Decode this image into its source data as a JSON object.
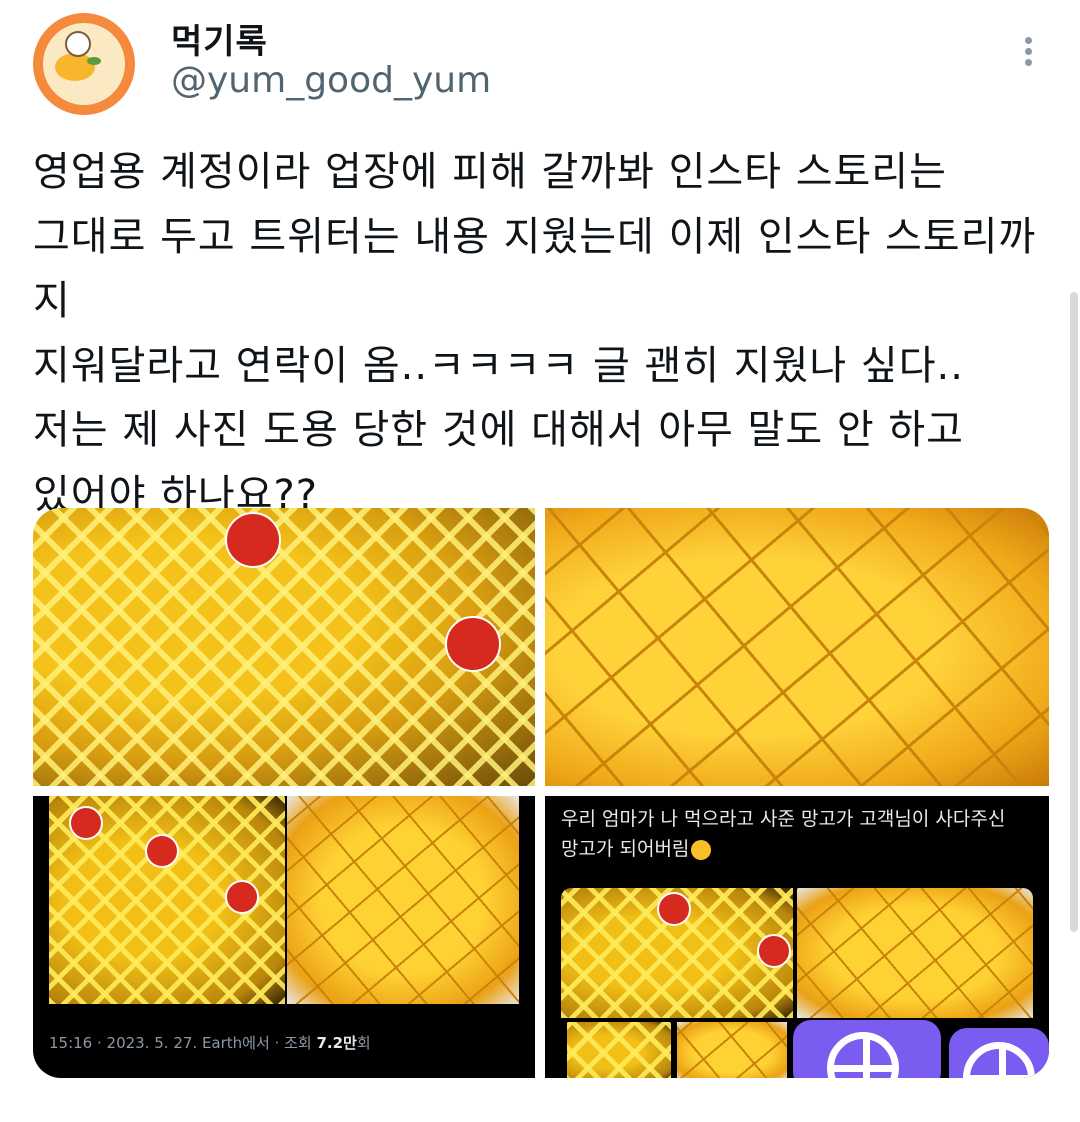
{
  "header": {
    "display_name": "먹기록",
    "handle": "@yum_good_yum",
    "avatar_icon": "cartoon-food-avatar",
    "more_icon": "more-vertical-icon"
  },
  "tweet": {
    "text": "영업용 계정이라 업장에 피해 갈까봐 인스타 스토리는\n그대로 두고 트위터는 내용 지웠는데 이제 인스타 스토리까지\n지워달라고 연락이 옴..ㅋㅋㅋㅋ 글 괜히 지웠나 싶다..\n저는 제 사진 도용 당한 것에 대해서 아무 말도 안 하고\n있어야 하나요??"
  },
  "media": {
    "image1": "mango-box-photo",
    "image2": "cut-mango-photo",
    "image3": {
      "meta_prefix": "15:16 · 2023. 5. 27. Earth에서 · 조회 ",
      "meta_views": "7.2만",
      "meta_suffix": "회"
    },
    "image4": {
      "caption": "우리 엄마가 나 먹으라고 사준 망고가 고객님이 사다주신\n망고가 되어버림"
    }
  },
  "colors": {
    "text": "#0f1419",
    "secondary": "#536471",
    "mango": "#f4c21a",
    "sticker": "#d62a1e",
    "purple": "#7a5cf0"
  }
}
